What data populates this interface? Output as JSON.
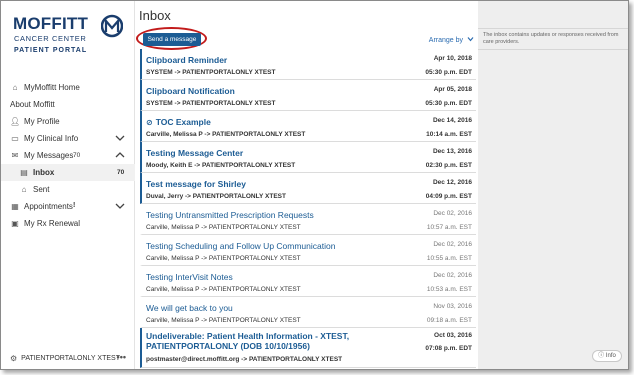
{
  "brand": {
    "name": "MOFFITT",
    "subtitle": "CANCER CENTER",
    "portal": "PATIENT PORTAL"
  },
  "sidebar": {
    "items": [
      {
        "label": "MyMoffitt Home",
        "icon": "home-icon"
      },
      {
        "label": "About Moffitt",
        "icon": ""
      },
      {
        "label": "My Profile",
        "icon": "user-icon"
      },
      {
        "label": "My Clinical Info",
        "icon": "document-icon"
      },
      {
        "label": "My Messages",
        "icon": "envelope-icon",
        "count": "70"
      },
      {
        "label": "Inbox",
        "icon": "inbox-icon",
        "count": "70"
      },
      {
        "label": "Sent",
        "icon": "sent-icon"
      },
      {
        "label": "Appointments",
        "icon": "calendar-icon",
        "badge": "!"
      },
      {
        "label": "My Rx Renewal",
        "icon": "rx-icon"
      }
    ],
    "user": "PATIENTPORTALONLY XTEST",
    "user_menu": "•••"
  },
  "main": {
    "title": "Inbox",
    "send_button": "Send a message",
    "arrange_label": "Arrange by",
    "messages": [
      {
        "subject": "Clipboard Reminder",
        "from": "SYSTEM -> PATIENTPORTALONLY XTEST",
        "date": "Apr 10, 2018",
        "time": "05:30 p.m. EDT",
        "unread": true
      },
      {
        "subject": "Clipboard Notification",
        "from": "SYSTEM -> PATIENTPORTALONLY XTEST",
        "date": "Apr 05, 2018",
        "time": "05:30 p.m. EDT",
        "unread": true
      },
      {
        "subject": "TOC Example",
        "from": "Carville, Melissa P -> PATIENTPORTALONLY XTEST",
        "date": "Dec 14, 2016",
        "time": "10:14 a.m. EST",
        "unread": true,
        "attachment": true
      },
      {
        "subject": "Testing Message Center",
        "from": "Moody, Keith E -> PATIENTPORTALONLY XTEST",
        "date": "Dec 13, 2016",
        "time": "02:30 p.m. EST",
        "unread": true
      },
      {
        "subject": "Test message for Shirley",
        "from": "Duval, Jerry -> PATIENTPORTALONLY XTEST",
        "date": "Dec 12, 2016",
        "time": "04:09 p.m. EST",
        "unread": true
      },
      {
        "subject": "Testing Untransmitted Prescription Requests",
        "from": "Carville, Melissa P -> PATIENTPORTALONLY XTEST",
        "date": "Dec 02, 2016",
        "time": "10:57 a.m. EST",
        "unread": false
      },
      {
        "subject": "Testing Scheduling and Follow Up Communication",
        "from": "Carville, Melissa P -> PATIENTPORTALONLY XTEST",
        "date": "Dec 02, 2016",
        "time": "10:55 a.m. EST",
        "unread": false
      },
      {
        "subject": "Testing InterVisit Notes",
        "from": "Carville, Melissa P -> PATIENTPORTALONLY XTEST",
        "date": "Dec 02, 2016",
        "time": "10:53 a.m. EST",
        "unread": false
      },
      {
        "subject": "We will get back to you",
        "from": "Carville, Melissa P -> PATIENTPORTALONLY XTEST",
        "date": "Nov 03, 2016",
        "time": "09:18 a.m. EST",
        "unread": false
      },
      {
        "subject": "Undeliverable: Patient Health Information - XTEST, PATIENTPORTALONLY (DOB 10/10/1956)",
        "from": "postmaster@direct.moffitt.org -> PATIENTPORTALONLY XTEST",
        "date": "Oct 03, 2016",
        "time": "07:08 p.m. EDT",
        "unread": true,
        "tall": true
      }
    ]
  },
  "rightpanel": {
    "info_text": "The inbox contains updates or responses received from care providers.",
    "info_button": "Info"
  },
  "colors": {
    "brand": "#1a3d6d",
    "accent": "#1c5c94",
    "highlight": "#c21b1b"
  }
}
